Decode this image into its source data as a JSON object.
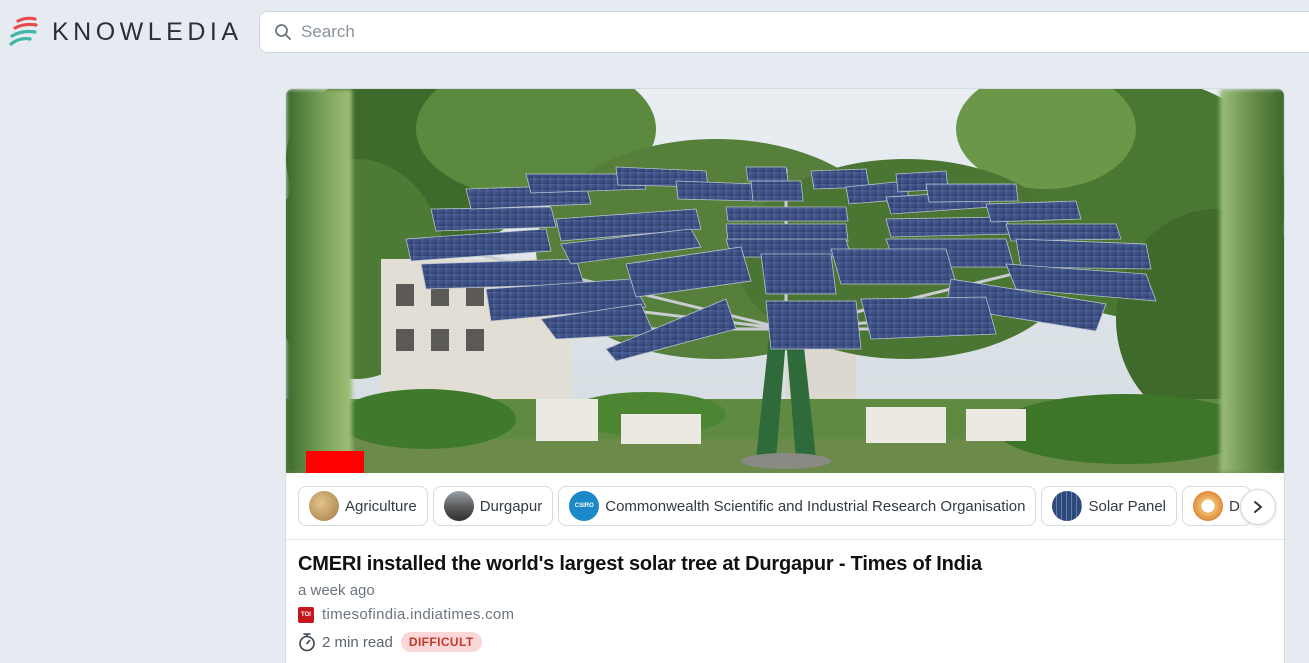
{
  "app": {
    "brand": "KNOWLEDIA"
  },
  "search": {
    "placeholder": "Search"
  },
  "article": {
    "title": "CMERI installed the world's largest solar tree at Durgapur - Times of India",
    "time_ago": "a week ago",
    "source": "timesofindia.indiatimes.com",
    "read_time": "2 min read",
    "difficulty": "DIFFICULT"
  },
  "topics": [
    {
      "label": "Agriculture",
      "thumb": "#c9a66b"
    },
    {
      "label": "Durgapur",
      "thumb": "#6b6b6b"
    },
    {
      "label": "Commonwealth Scientific and Industrial Research Organisation",
      "thumb": "#1d88c8"
    },
    {
      "label": "Solar Panel",
      "thumb": "#34507a"
    },
    {
      "label": "D",
      "thumb": "#f0c070"
    }
  ],
  "colors": {
    "accent_red": "#e94b4b",
    "accent_teal": "#3fb6a8",
    "badge_bg": "#fbd7d7",
    "badge_text": "#c0392b"
  },
  "icons": {
    "search": "search-icon",
    "timer": "stopwatch-icon",
    "next": "chevron-right-icon"
  }
}
